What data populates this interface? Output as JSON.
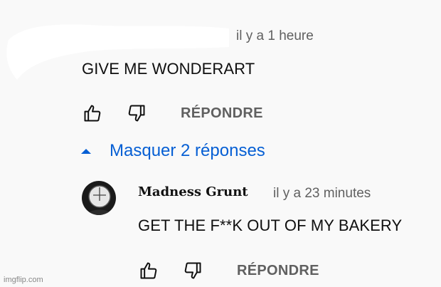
{
  "top_comment": {
    "time": "il y a 1 heure",
    "text": "GIVE ME WONDERART",
    "reply_label": "RÉPONDRE"
  },
  "replies_toggle": {
    "label": "Masquer 2 réponses",
    "icon": "caret-up-icon",
    "color": "#065fd4"
  },
  "reply_comment": {
    "author": "Madness Grunt",
    "time": "il y a 23 minutes",
    "text": "GET THE F**K OUT OF MY BAKERY",
    "reply_label": "RÉPONDRE"
  },
  "watermark": "imgflip.com"
}
